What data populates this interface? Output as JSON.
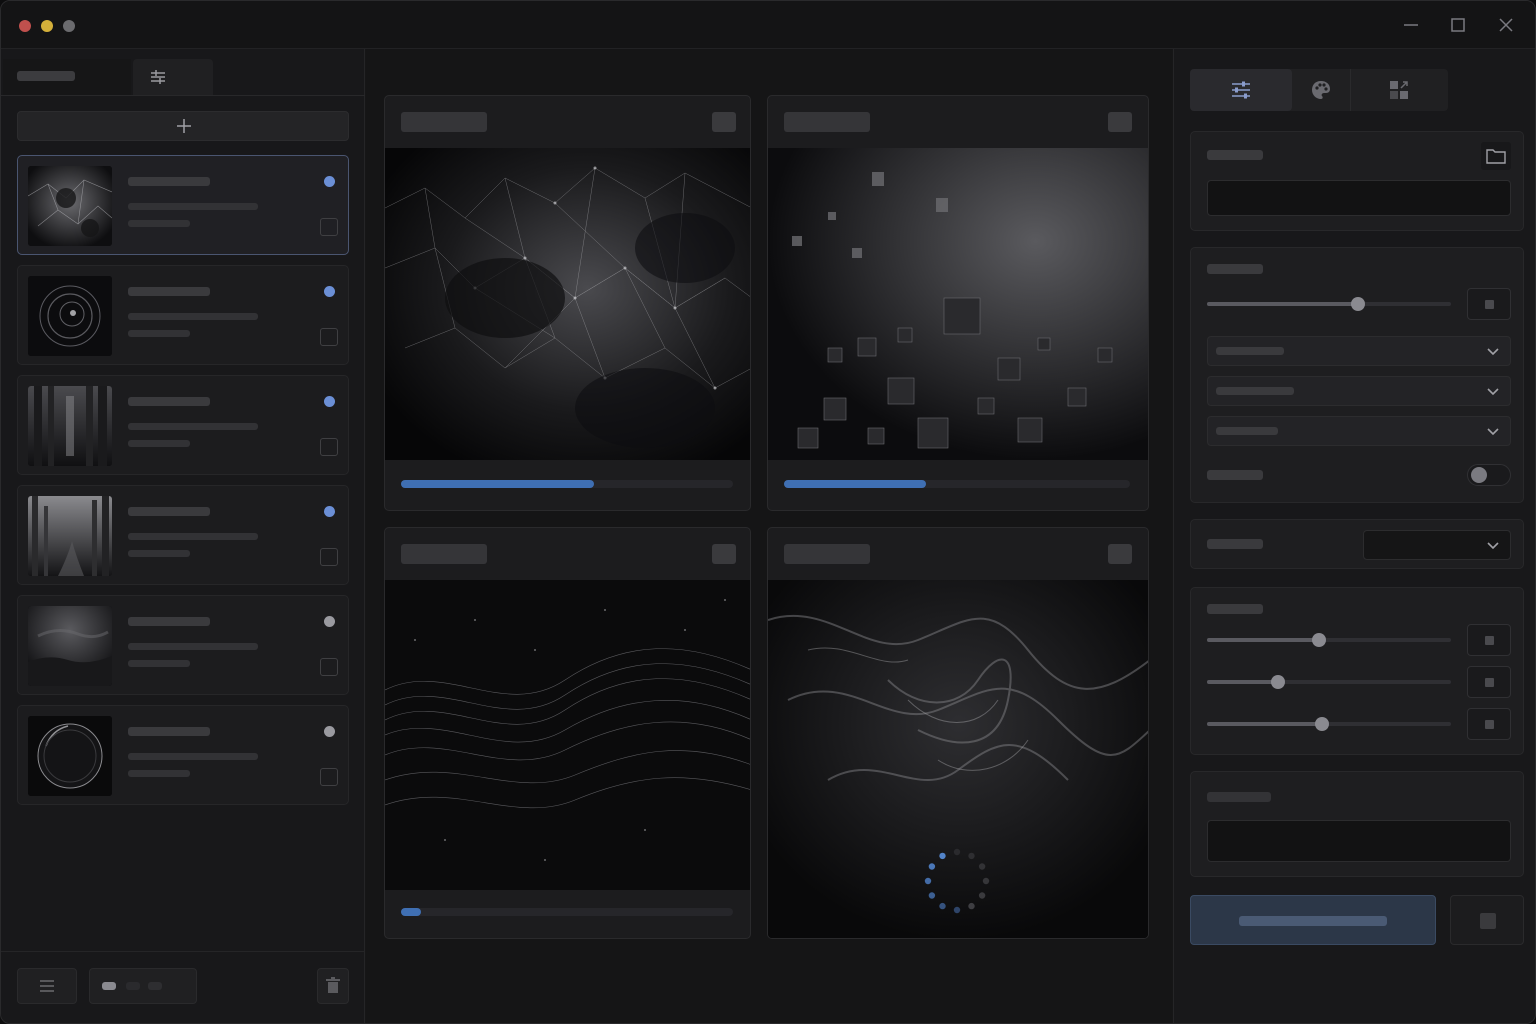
{
  "window": {
    "controls": [
      "close-dot",
      "minimize-dot",
      "zoom-dot",
      "minimize-icon",
      "maximize-icon",
      "close-icon"
    ],
    "colors": {
      "close": "#c0504d",
      "minimize": "#d4b03a",
      "zoom": "#6b6b6e"
    }
  },
  "sidebar": {
    "tabs": [
      {
        "name": "tab-queue",
        "icon": "none",
        "active": false
      },
      {
        "name": "tab-adjust",
        "icon": "sliders-icon",
        "active": true
      }
    ],
    "add_button_icon": "plus-icon",
    "queue_items": [
      {
        "name": "queue-item-1",
        "thumbnail": "plexus-network",
        "status": "queued",
        "status_color": "#6b8fd6",
        "selected": true,
        "checked": false
      },
      {
        "name": "queue-item-2",
        "thumbnail": "dark-vortex",
        "status": "queued",
        "status_color": "#6b8fd6",
        "selected": false,
        "checked": false
      },
      {
        "name": "queue-item-3",
        "thumbnail": "forest-corridor",
        "status": "queued",
        "status_color": "#6b8fd6",
        "selected": false,
        "checked": false
      },
      {
        "name": "queue-item-4",
        "thumbnail": "misty-forest-river",
        "status": "queued",
        "status_color": "#6b8fd6",
        "selected": false,
        "checked": false
      },
      {
        "name": "queue-item-5",
        "thumbnail": "stormy-landscape",
        "status": "idle",
        "status_color": "#9a9aa0",
        "selected": false,
        "checked": false
      },
      {
        "name": "queue-item-6",
        "thumbnail": "glass-sphere",
        "status": "idle",
        "status_color": "#9a9aa0",
        "selected": false,
        "checked": false
      }
    ],
    "bottom_buttons": [
      "menu-icon",
      "view-toggle",
      "trash-icon"
    ]
  },
  "cards": [
    {
      "name": "render-card-plexus",
      "image": "plexus-network",
      "progress": 0.58,
      "state": "rendering"
    },
    {
      "name": "render-card-cubes",
      "image": "floating-cubes",
      "progress": 0.41,
      "state": "rendering"
    },
    {
      "name": "render-card-waves",
      "image": "particle-waves",
      "progress": 0.06,
      "state": "rendering"
    },
    {
      "name": "render-card-fluid",
      "image": "fluid-swirl",
      "progress": null,
      "state": "loading"
    }
  ],
  "right_panel": {
    "tabs": [
      {
        "name": "tab-settings",
        "icon": "sliders-icon",
        "active": true
      },
      {
        "name": "tab-palette",
        "icon": "palette-icon",
        "active": false
      },
      {
        "name": "tab-layout",
        "icon": "layout-icon",
        "active": false
      }
    ],
    "sliders": [
      {
        "name": "slider-main",
        "value": 0.62
      },
      {
        "name": "slider-a",
        "value": 0.46
      },
      {
        "name": "slider-b",
        "value": 0.29
      },
      {
        "name": "slider-c",
        "value": 0.47
      }
    ],
    "toggle_on": false,
    "accent": "#3f6fb3"
  }
}
